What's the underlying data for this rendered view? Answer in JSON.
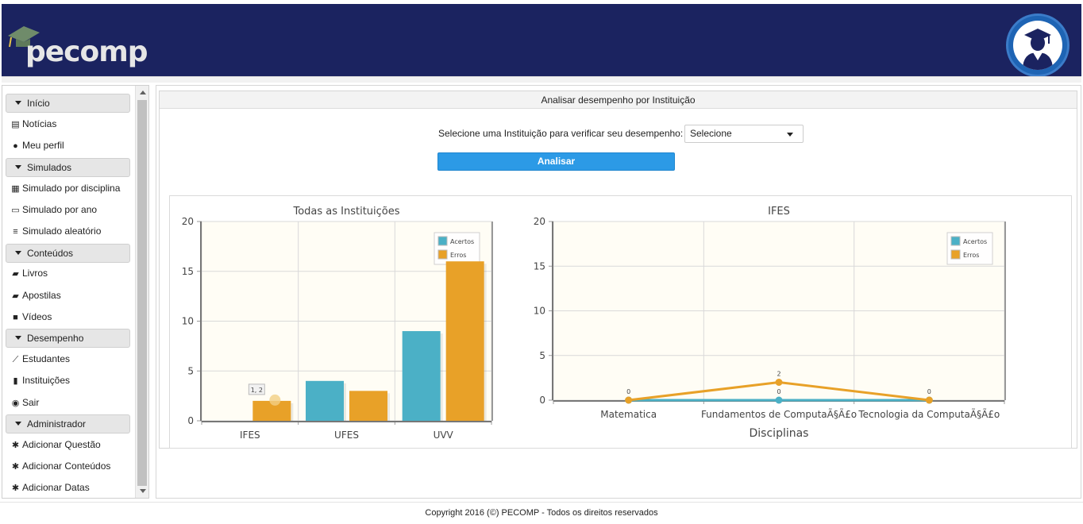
{
  "brand": {
    "logo_text": "pecomp",
    "header_bg": "#1b2360"
  },
  "sidebar": {
    "sections": [
      {
        "label": "Início",
        "items": [
          {
            "icon": "newspaper-icon",
            "label": "Notícias"
          },
          {
            "icon": "user-icon",
            "label": "Meu perfil"
          }
        ]
      },
      {
        "label": "Simulados",
        "items": [
          {
            "icon": "table-icon",
            "label": "Simulado por disciplina"
          },
          {
            "icon": "calendar-icon",
            "label": "Simulado por ano"
          },
          {
            "icon": "list-icon",
            "label": "Simulado aleatório"
          }
        ]
      },
      {
        "label": "Conteúdos",
        "items": [
          {
            "icon": "book-icon",
            "label": "Livros"
          },
          {
            "icon": "book-icon",
            "label": "Apostilas"
          },
          {
            "icon": "video-camera-icon",
            "label": "Vídeos"
          }
        ]
      },
      {
        "label": "Desempenho",
        "items": [
          {
            "icon": "line-chart-icon",
            "label": "Estudantes"
          },
          {
            "icon": "bar-chart-icon",
            "label": "Instituições"
          },
          {
            "icon": "power-icon",
            "label": "Sair"
          }
        ]
      },
      {
        "label": "Administrador",
        "items": [
          {
            "icon": "gear-icon",
            "label": "Adicionar Questão"
          },
          {
            "icon": "gear-icon",
            "label": "Adicionar Conteúdos"
          },
          {
            "icon": "gear-icon",
            "label": "Adicionar Datas"
          }
        ]
      }
    ]
  },
  "main": {
    "panel_title": "Analisar desempenho por Instituição",
    "select_label": "Selecione uma Instituição para verificar seu desempenho:",
    "select_value": "Selecione",
    "analyze_label": "Analisar"
  },
  "chart_data": [
    {
      "type": "bar",
      "title": "Todas as Instituições",
      "categories": [
        "IFES",
        "UFES",
        "UVV"
      ],
      "series": [
        {
          "name": "Acertos",
          "color": "#4bb0c6",
          "values": [
            0,
            4,
            9
          ]
        },
        {
          "name": "Erros",
          "color": "#e8a128",
          "values": [
            2,
            3,
            16
          ]
        }
      ],
      "ylim": [
        0,
        20
      ],
      "yticks": [
        0,
        5,
        10,
        15,
        20
      ],
      "legend": "top-right",
      "grid": true,
      "tooltip": {
        "text": "1, 2"
      }
    },
    {
      "type": "line",
      "title": "IFES",
      "xlabel": "Disciplinas",
      "categories": [
        "Matematica",
        "Fundamentos de ComputaÃ§Ã£o",
        "Tecnologia da ComputaÃ§Ã£o"
      ],
      "series": [
        {
          "name": "Acertos",
          "color": "#4bb0c6",
          "values": [
            0,
            0,
            0
          ]
        },
        {
          "name": "Erros",
          "color": "#e8a128",
          "values": [
            0,
            2,
            0
          ]
        }
      ],
      "ylim": [
        0,
        20
      ],
      "yticks": [
        0,
        5,
        10,
        15,
        20
      ],
      "legend": "top-right",
      "grid": true
    }
  ],
  "footer": {
    "text": "Copyright 2016 (©) PECOMP - Todos os direitos reservados"
  }
}
